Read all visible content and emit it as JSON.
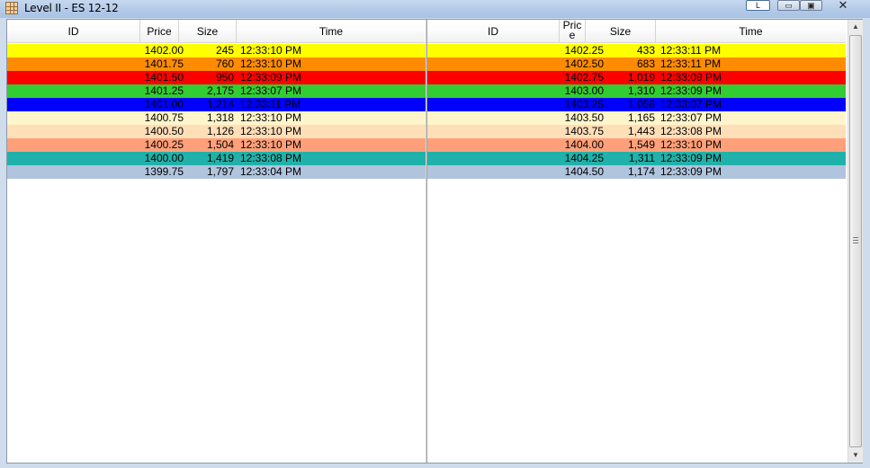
{
  "window": {
    "title": "Level II - ES 12-12",
    "buttons": {
      "l_label": "L",
      "minimize": "▭",
      "maximize": "▣",
      "close": "✕"
    }
  },
  "bid_pane": {
    "headers": {
      "id": "ID",
      "price": "Price",
      "size": "Size",
      "time": "Time"
    },
    "rows": [
      {
        "id": "",
        "price": "1402.00",
        "size": "245",
        "time": "12:33:10 PM",
        "bg": "#ffff00"
      },
      {
        "id": "",
        "price": "1401.75",
        "size": "760",
        "time": "12:33:10 PM",
        "bg": "#ff8c00"
      },
      {
        "id": "",
        "price": "1401.50",
        "size": "950",
        "time": "12:33:09 PM",
        "bg": "#ff0000"
      },
      {
        "id": "",
        "price": "1401.25",
        "size": "2,175",
        "time": "12:33:07 PM",
        "bg": "#32cd32"
      },
      {
        "id": "",
        "price": "1401.00",
        "size": "1,214",
        "time": "12:33:11 PM",
        "bg": "#0000ff"
      },
      {
        "id": "",
        "price": "1400.75",
        "size": "1,318",
        "time": "12:33:10 PM",
        "bg": "#fff5cc"
      },
      {
        "id": "",
        "price": "1400.50",
        "size": "1,126",
        "time": "12:33:10 PM",
        "bg": "#ffdfb8"
      },
      {
        "id": "",
        "price": "1400.25",
        "size": "1,504",
        "time": "12:33:10 PM",
        "bg": "#ffa07a"
      },
      {
        "id": "",
        "price": "1400.00",
        "size": "1,419",
        "time": "12:33:08 PM",
        "bg": "#20b2aa"
      },
      {
        "id": "",
        "price": "1399.75",
        "size": "1,797",
        "time": "12:33:04 PM",
        "bg": "#b0c4de"
      }
    ]
  },
  "ask_pane": {
    "headers": {
      "id": "ID",
      "price": "Pric e",
      "size": "Size",
      "time": "Time"
    },
    "rows": [
      {
        "id": "",
        "price": "1402.25",
        "size": "433",
        "time": "12:33:11 PM",
        "bg": "#ffff00"
      },
      {
        "id": "",
        "price": "1402.50",
        "size": "683",
        "time": "12:33:11 PM",
        "bg": "#ff8c00"
      },
      {
        "id": "",
        "price": "1402.75",
        "size": "1,019",
        "time": "12:33:09 PM",
        "bg": "#ff0000"
      },
      {
        "id": "",
        "price": "1403.00",
        "size": "1,310",
        "time": "12:33:09 PM",
        "bg": "#32cd32"
      },
      {
        "id": "",
        "price": "1403.25",
        "size": "1,058",
        "time": "12:33:07 PM",
        "bg": "#0000ff"
      },
      {
        "id": "",
        "price": "1403.50",
        "size": "1,165",
        "time": "12:33:07 PM",
        "bg": "#fff5cc"
      },
      {
        "id": "",
        "price": "1403.75",
        "size": "1,443",
        "time": "12:33:08 PM",
        "bg": "#ffdfb8"
      },
      {
        "id": "",
        "price": "1404.00",
        "size": "1,549",
        "time": "12:33:10 PM",
        "bg": "#ffa07a"
      },
      {
        "id": "",
        "price": "1404.25",
        "size": "1,311",
        "time": "12:33:09 PM",
        "bg": "#20b2aa"
      },
      {
        "id": "",
        "price": "1404.50",
        "size": "1,174",
        "time": "12:33:09 PM",
        "bg": "#b0c4de"
      }
    ]
  },
  "scrollbar": {
    "up_icon": "▲",
    "down_icon": "▼"
  }
}
